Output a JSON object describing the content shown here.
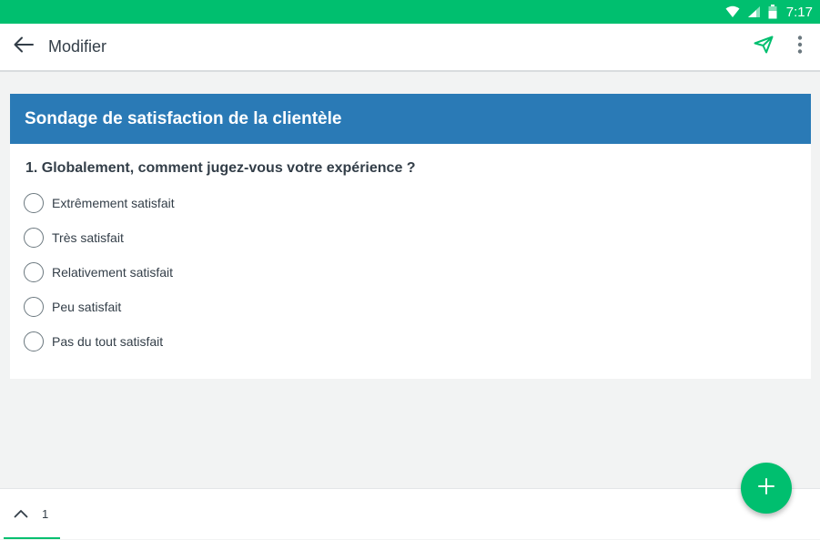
{
  "status_bar": {
    "time": "7:17",
    "icons": [
      "wifi-icon",
      "signal-icon",
      "battery-icon"
    ]
  },
  "app_bar": {
    "back_icon": "arrow-left-icon",
    "title": "Modifier",
    "actions": [
      "send-icon",
      "more-vert-icon"
    ]
  },
  "survey": {
    "title": "Sondage de satisfaction de la clientèle",
    "question": "1. Globalement, comment jugez-vous votre expérience ?",
    "options": [
      "Extrêmement satisfait",
      "Très satisfait",
      "Relativement satisfait",
      "Peu satisfait",
      "Pas du tout satisfait"
    ]
  },
  "bottom_bar": {
    "up_icon": "chevron-up-icon",
    "page": "1"
  },
  "fab": {
    "icon": "plus-icon"
  },
  "colors": {
    "accent_green": "#00bf6f",
    "header_blue": "#2a7ab6",
    "background": "#f2f3f3"
  }
}
